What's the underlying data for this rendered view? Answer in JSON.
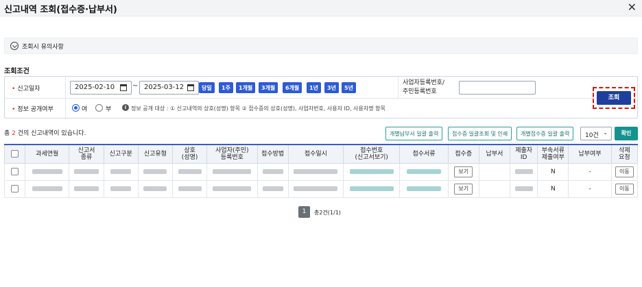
{
  "window": {
    "title": "신고내역 조회(접수증·납부서)",
    "close_glyph": "✕"
  },
  "notice": {
    "label": "조회시 유의사항"
  },
  "section": {
    "title": "조회조건"
  },
  "conditions": {
    "report_date_label": "신고일자",
    "start_date": "2025-02-10",
    "end_date": "2025-03-12",
    "tilde": "~",
    "period_buttons": [
      "당일",
      "1주",
      "1개월",
      "3개월",
      "6개월",
      "1년",
      "3년",
      "5년"
    ],
    "biz_label_line1": "사업자등록번호/",
    "biz_label_line2": "주민등록번호",
    "biz_value": "",
    "search_button": "조회",
    "disclosure_label": "정보 공개여부",
    "radio_yes": "여",
    "radio_no": "부",
    "radio_selected": "여",
    "info_text": "정보 공개 대상 : ① 신고내역의 상호(성명) 항목 ② 접수증의 상호(성명), 사업자번호, 사용자 ID, 사용자명 항목"
  },
  "results": {
    "count_prefix": "총 ",
    "count": "2",
    "count_suffix": " 건의 신고내역이 있습니다.",
    "btn_tax_bill_print": "개별납부서 일괄 출력",
    "btn_receipt_view_print": "접수증 일괄조회 및 인쇄",
    "btn_receipt_print": "개별접수증 일괄 출력",
    "page_size": "10건",
    "confirm_button": "확인"
  },
  "table": {
    "headers": [
      "",
      "과세연월",
      "신고서\n종류",
      "신고구분",
      "신고유형",
      "상호\n(성명)",
      "사업자(주민)\n등록번호",
      "접수방법",
      "접수일시",
      "접수번호\n(신고서보기)",
      "접수서류",
      "접수증",
      "납부서",
      "제출자\nID",
      "부속서류\n제출여부",
      "납부여부",
      "삭제\n요청"
    ],
    "rows": [
      {
        "receipt": "보기",
        "tax_bill": "",
        "attached": "N",
        "paid": "-",
        "delete": "이동"
      },
      {
        "receipt": "보기",
        "tax_bill": "",
        "attached": "N",
        "paid": "-",
        "delete": "이동"
      }
    ]
  },
  "pagination": {
    "current": "1",
    "summary": "총2건(1/1)"
  }
}
